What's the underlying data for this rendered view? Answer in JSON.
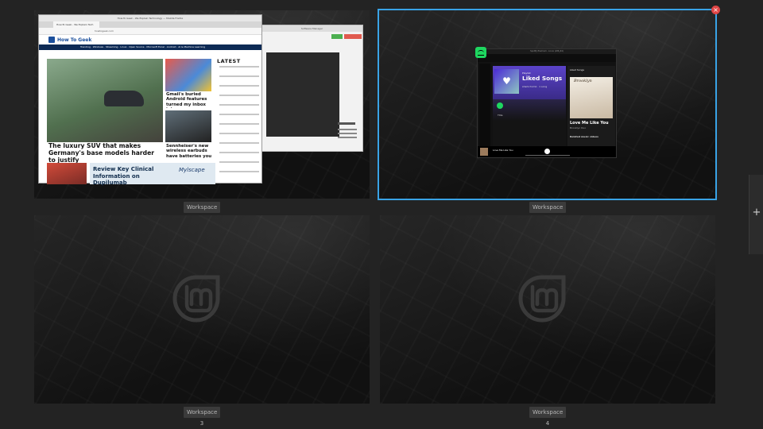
{
  "workspaces": [
    {
      "label": "Workspace 1"
    },
    {
      "label": "Workspace 2"
    },
    {
      "label": "Workspace 3"
    },
    {
      "label": "Workspace 4"
    }
  ],
  "ws1": {
    "browser_title": "How-To Geek - We Explain Technology — Mozilla Firefox",
    "tab_label": "How-To Geek - We Explain Tech",
    "url": "howtogeek.com",
    "site_name": "How To Geek",
    "nav_items": "Trending · Windows · Streaming · Linux · Open Source · Microsoft Excel · Android · AI & Machine Learning",
    "main_headline": "The luxury SUV that makes Germany's base models harder to justify",
    "side_headline_1": "Gmail's buried Android features turned my inbox into a productivity...",
    "side_headline_2": "Sennheiser's new wireless earbuds have batteries you can...",
    "latest_heading": "LATEST",
    "ad_text": "Review Key Clinical Information on Dupilumab",
    "ad_brand": "Mylscape",
    "back_window_title": "Software Manager"
  },
  "ws2": {
    "app_title": "Spotify Premium - Linux (x86_64)",
    "playlist_type": "Playlist",
    "playlist_title": "Liked Songs",
    "playlist_owner": "sharkchomk · 1 song",
    "right_header": "Liked Songs",
    "album_text": "Brooklyn",
    "song_title": "Love Me Like You",
    "song_artist": "Brooklyn Duo",
    "related_videos": "Related music videos",
    "now_playing": "Love Me Like You",
    "row_title": "Title"
  },
  "add_workspace_icon": "plus-icon",
  "close_icon": "close-icon",
  "colors": {
    "selection_border": "#39a3e6",
    "close_red": "#e04646",
    "spotify_green": "#1ed760",
    "label_bg": "#3b3b3b"
  }
}
